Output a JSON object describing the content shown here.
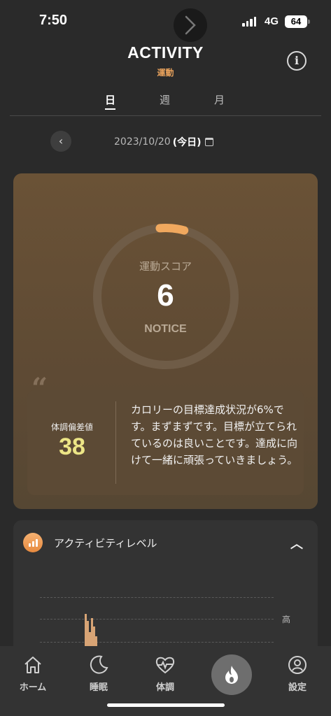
{
  "status_bar": {
    "time": "7:50",
    "network": "4G",
    "battery": "64"
  },
  "header": {
    "title": "ACTIVITY",
    "subtitle": "運動"
  },
  "tabs": [
    {
      "label": "日"
    },
    {
      "label": "週"
    },
    {
      "label": "月"
    }
  ],
  "date": {
    "value": "2023/10/20",
    "today": "(今日)"
  },
  "score_card": {
    "label": "運動スコア",
    "value": "6",
    "status": "NOTICE",
    "progress_fraction": 0.06,
    "deviation_label": "体調偏差値",
    "deviation_value": "38",
    "message": "カロリーの目標達成状況が6%です。まずまずです。目標が立てられているのは良いことです。達成に向けて一緒に頑張っていきましょう。"
  },
  "activity_card": {
    "title": "アクティビティレベル",
    "grid_label": "高"
  },
  "tabbar": {
    "items": [
      {
        "label": "ホーム"
      },
      {
        "label": "睡眠"
      },
      {
        "label": "体調"
      },
      {
        "label": "設定"
      }
    ]
  },
  "colors": {
    "accent": "#e9a25c",
    "card_bg": "#5e4a34",
    "deviation": "#ece586"
  }
}
